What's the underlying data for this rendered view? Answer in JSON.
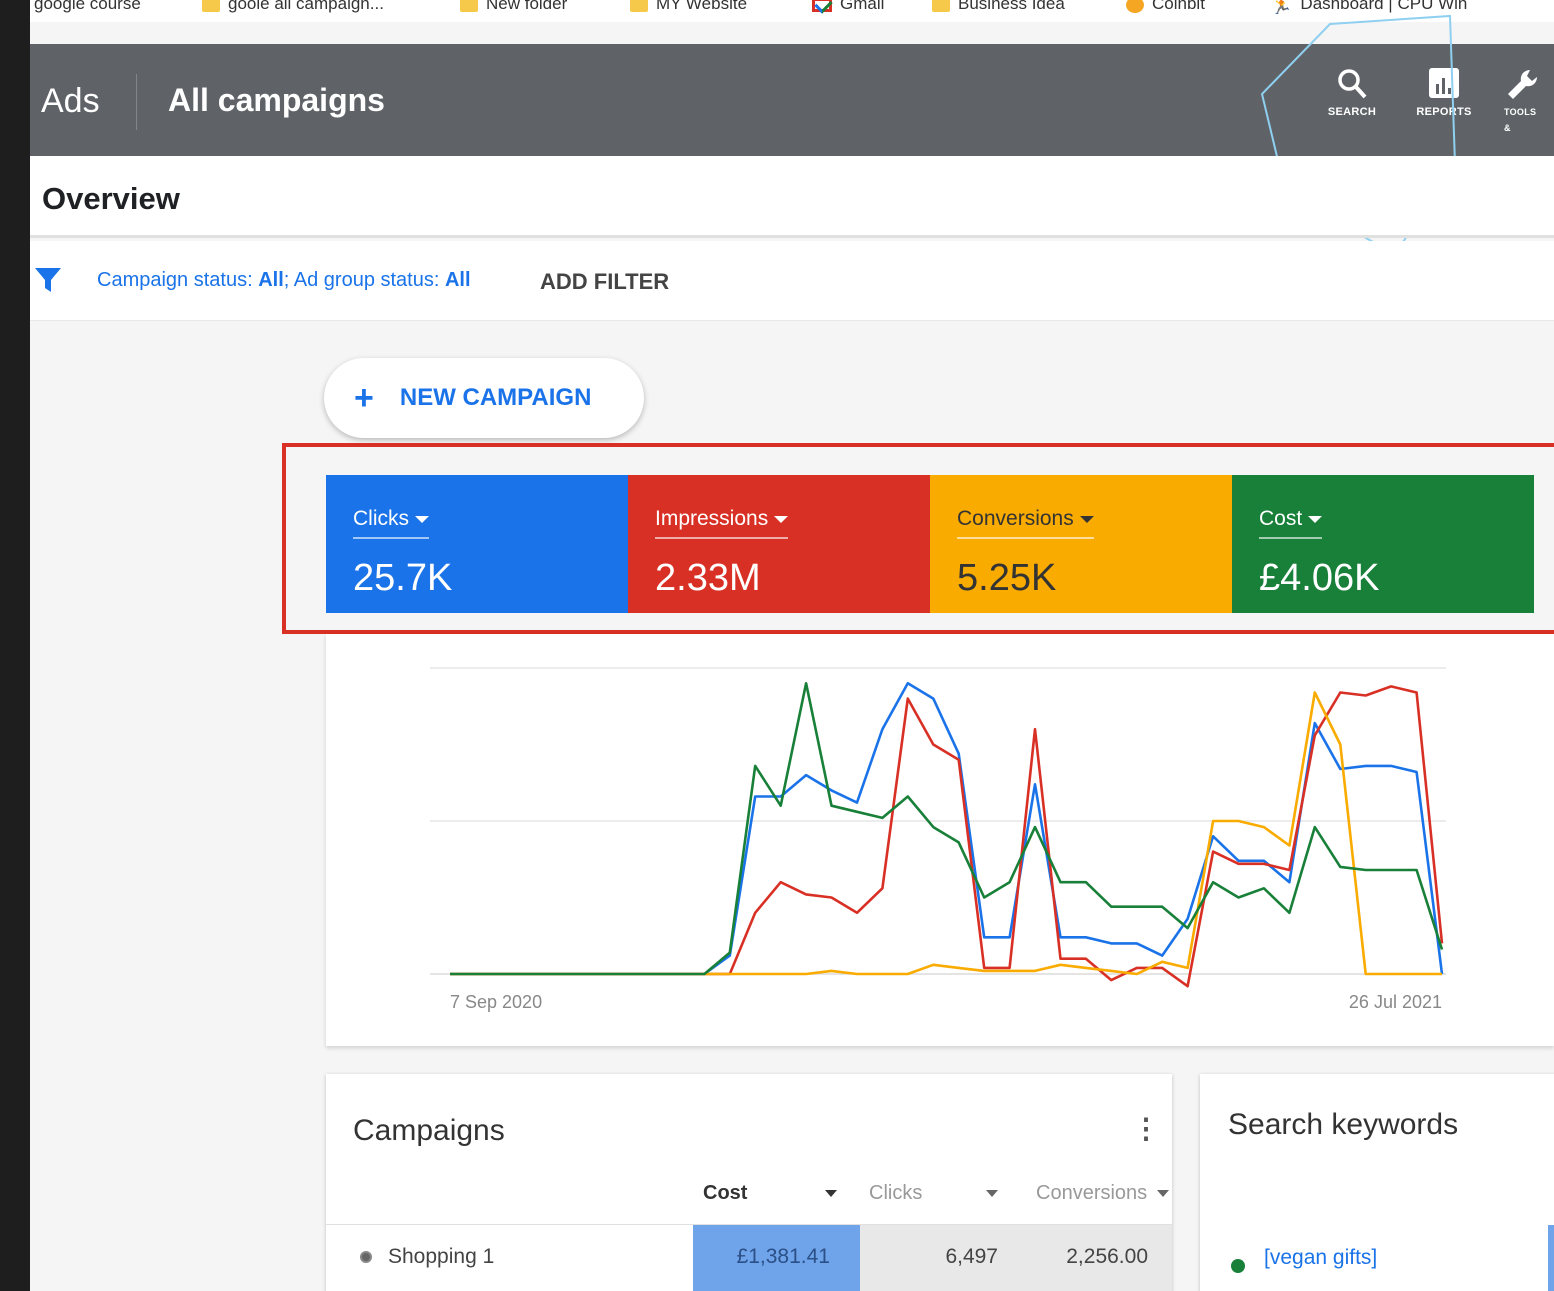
{
  "bookmarks": [
    {
      "label": "google course",
      "icon": "none"
    },
    {
      "label": "goole all campaign...",
      "icon": "folder"
    },
    {
      "label": "New folder",
      "icon": "folder"
    },
    {
      "label": "MY Website",
      "icon": "folder"
    },
    {
      "label": "Gmail",
      "icon": "gmail"
    },
    {
      "label": "Business Idea",
      "icon": "folder"
    },
    {
      "label": "Coinbit",
      "icon": "coin"
    },
    {
      "label": "Dashboard | CPU Win",
      "icon": "runner"
    }
  ],
  "header": {
    "app": "Ads",
    "title": "All campaigns",
    "buttons": [
      {
        "label": "SEARCH",
        "icon": "search-icon"
      },
      {
        "label": "REPORTS",
        "icon": "reports-icon"
      },
      {
        "label": "TOOLS & SETTINGS",
        "icon": "wrench-icon"
      }
    ]
  },
  "overview": {
    "title": "Overview"
  },
  "filter": {
    "status_prefix": "Campaign status: ",
    "status_value": "All",
    "sep": "; Ad group status: ",
    "adgroup_value": "All",
    "add": "ADD FILTER"
  },
  "new_campaign": {
    "label": "NEW CAMPAIGN"
  },
  "metrics": [
    {
      "label": "Clicks",
      "value": "25.7K",
      "color": "#1a73e8",
      "text": "#ffffff"
    },
    {
      "label": "Impressions",
      "value": "2.33M",
      "color": "#d93025",
      "text": "#ffffff"
    },
    {
      "label": "Conversions",
      "value": "5.25K",
      "color": "#f9ab00",
      "text": "#333333"
    },
    {
      "label": "Cost",
      "value": "£4.06K",
      "color": "#188038",
      "text": "#ffffff"
    }
  ],
  "chart_data": {
    "type": "line",
    "title": "",
    "xlabel": "",
    "ylabel": "",
    "x_start_label": "7 Sep 2020",
    "x_end_label": "26 Jul 2021",
    "ylim": [
      0,
      100
    ],
    "grid": true,
    "series": [
      {
        "color": "#1a73e8",
        "values": [
          0,
          0,
          0,
          0,
          0,
          0,
          0,
          0,
          0,
          0,
          0,
          6,
          58,
          58,
          65,
          60,
          56,
          80,
          95,
          90,
          72,
          12,
          12,
          62,
          12,
          12,
          10,
          10,
          6,
          18,
          45,
          37,
          37,
          30,
          82,
          67,
          68,
          68,
          66,
          0
        ]
      },
      {
        "color": "#d93025",
        "values": [
          0,
          0,
          0,
          0,
          0,
          0,
          0,
          0,
          0,
          0,
          0,
          0,
          20,
          30,
          26,
          25,
          20,
          28,
          90,
          75,
          70,
          2,
          2,
          80,
          5,
          5,
          -2,
          2,
          2,
          -4,
          40,
          36,
          36,
          34,
          78,
          92,
          91,
          94,
          92,
          10
        ]
      },
      {
        "color": "#f9ab00",
        "values": [
          0,
          0,
          0,
          0,
          0,
          0,
          0,
          0,
          0,
          0,
          0,
          0,
          0,
          0,
          0,
          1,
          0,
          0,
          0,
          3,
          2,
          1,
          1,
          1,
          3,
          2,
          1,
          0,
          4,
          2,
          50,
          50,
          48,
          42,
          92,
          75,
          0,
          0,
          0,
          0
        ]
      },
      {
        "color": "#188038",
        "values": [
          0,
          0,
          0,
          0,
          0,
          0,
          0,
          0,
          0,
          0,
          0,
          7,
          68,
          55,
          95,
          55,
          53,
          51,
          58,
          48,
          43,
          25,
          30,
          48,
          30,
          30,
          22,
          22,
          22,
          15,
          30,
          25,
          28,
          20,
          48,
          35,
          34,
          34,
          34,
          8
        ]
      }
    ]
  },
  "campaigns": {
    "title": "Campaigns",
    "columns": [
      "Cost",
      "Clicks",
      "Conversions"
    ],
    "rows": [
      {
        "name": "Shopping 1",
        "cost": "£1,381.41",
        "clicks": "6,497",
        "conversions": "2,256.00"
      }
    ]
  },
  "keywords": {
    "title": "Search keywords",
    "rows": [
      {
        "keyword": "[vegan gifts]",
        "status_color": "#188038"
      }
    ]
  }
}
